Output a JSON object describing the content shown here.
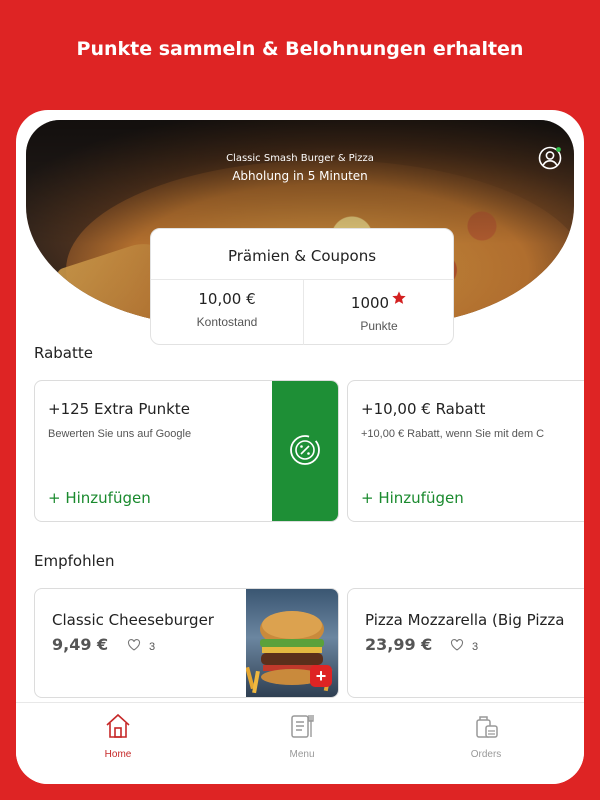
{
  "headline": "Punkte sammeln & Belohnungen erhalten",
  "hero": {
    "restaurant_name": "Classic Smash Burger & Pizza",
    "pickup_info": "Abholung in 5 Minuten",
    "profile_icon": "user-circle-icon"
  },
  "rewards": {
    "title": "Prämien & Coupons",
    "balance_value": "10,00 €",
    "balance_label": "Kontostand",
    "points_value": "1000",
    "points_label": "Punkte"
  },
  "discounts": {
    "section_title": "Rabatte",
    "items": [
      {
        "title": "+125 Extra Punkte",
        "description": "Bewerten Sie uns auf Google",
        "action": "+ Hinzufügen",
        "icon": "coupon-percent-icon"
      },
      {
        "title": "+10,00 € Rabatt",
        "description": "+10,00 € Rabatt, wenn Sie mit dem C",
        "action": "+ Hinzufügen"
      }
    ]
  },
  "recommended": {
    "section_title": "Empfohlen",
    "items": [
      {
        "name": "Classic Cheeseburger",
        "price": "9,49 €",
        "likes": "3"
      },
      {
        "name": "Pizza Mozzarella (Big Pizza",
        "price": "23,99 €",
        "likes": "3"
      }
    ]
  },
  "tabbar": {
    "tabs": [
      {
        "label": "Home",
        "icon": "home-icon",
        "active": true
      },
      {
        "label": "Menu",
        "icon": "menu-book-icon",
        "active": false
      },
      {
        "label": "Orders",
        "icon": "orders-bag-icon",
        "active": false
      }
    ]
  },
  "colors": {
    "brand_red": "#de2424",
    "accent_green": "#1e8f36",
    "action_green": "#1a8a2e"
  }
}
